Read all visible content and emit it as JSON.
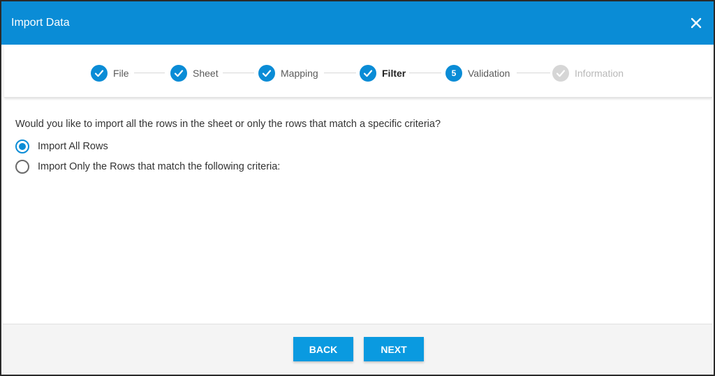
{
  "dialog": {
    "title": "Import Data"
  },
  "stepper": {
    "steps": [
      {
        "label": "File",
        "state": "done"
      },
      {
        "label": "Sheet",
        "state": "done"
      },
      {
        "label": "Mapping",
        "state": "done"
      },
      {
        "label": "Filter",
        "state": "active"
      },
      {
        "label": "Validation",
        "state": "current-number",
        "number": "5"
      },
      {
        "label": "Information",
        "state": "disabled"
      }
    ]
  },
  "main": {
    "question": "Would you like to import all the rows in the sheet or only the rows that match a specific criteria?",
    "options": [
      {
        "label": "Import All Rows",
        "checked": true
      },
      {
        "label": "Import Only the Rows that match the following criteria:",
        "checked": false
      }
    ]
  },
  "footer": {
    "back_label": "BACK",
    "next_label": "NEXT"
  },
  "colors": {
    "accent": "#0a8cd6",
    "button": "#0a9ae0",
    "disabled": "#d6d6d6"
  }
}
